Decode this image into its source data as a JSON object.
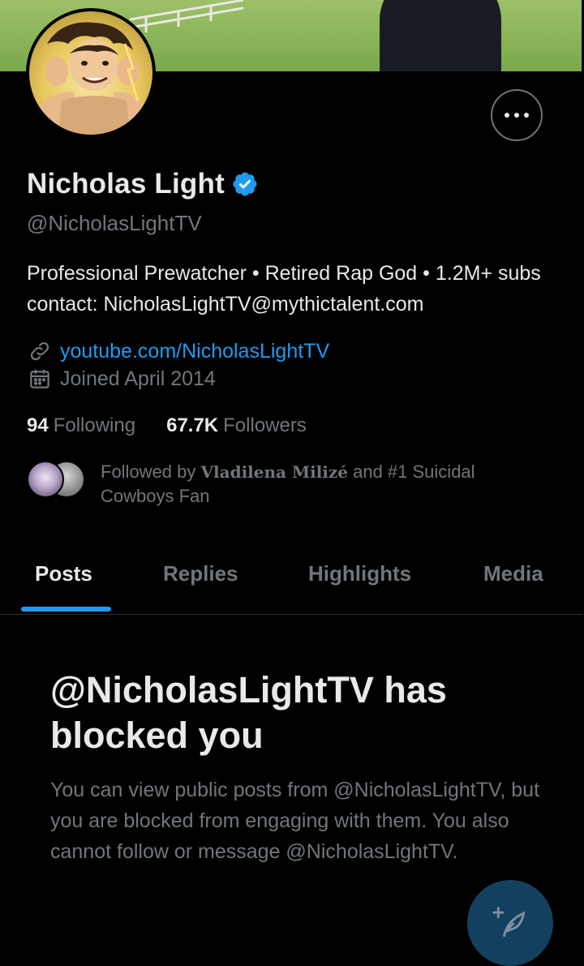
{
  "profile": {
    "name": "Nicholas Light",
    "handle": "@NicholasLightTV",
    "bio": "Professional Prewatcher • Retired Rap God • 1.2M+ subs contact: NicholasLightTV@mythictalent.com",
    "link": "youtube.com/NicholasLightTV",
    "joined": "Joined April 2014",
    "following_count": "94",
    "following_label": "Following",
    "followers_count": "67.7K",
    "followers_label": "Followers",
    "followed_by_prefix": "Followed by",
    "followed_by_name": "Vladilena Milizé",
    "followed_by_rest": "and #1 Suicidal Cowboys Fan"
  },
  "tabs": [
    {
      "label": "Posts"
    },
    {
      "label": "Replies"
    },
    {
      "label": "Highlights"
    },
    {
      "label": "Media"
    }
  ],
  "blocked": {
    "title": "@NicholasLightTV has blocked you",
    "description": "You can view public posts from @NicholasLightTV, but you are blocked from engaging with them. You also cannot follow or message @NicholasLightTV."
  },
  "icons": {
    "more": "more-icon",
    "verified": "verified-badge-icon",
    "link": "link-icon",
    "calendar": "calendar-icon",
    "compose": "compose-post-icon"
  },
  "colors": {
    "accent": "#1d9bf0",
    "background": "#000000",
    "text_primary": "#e7e9ea",
    "text_secondary": "#71767b"
  }
}
